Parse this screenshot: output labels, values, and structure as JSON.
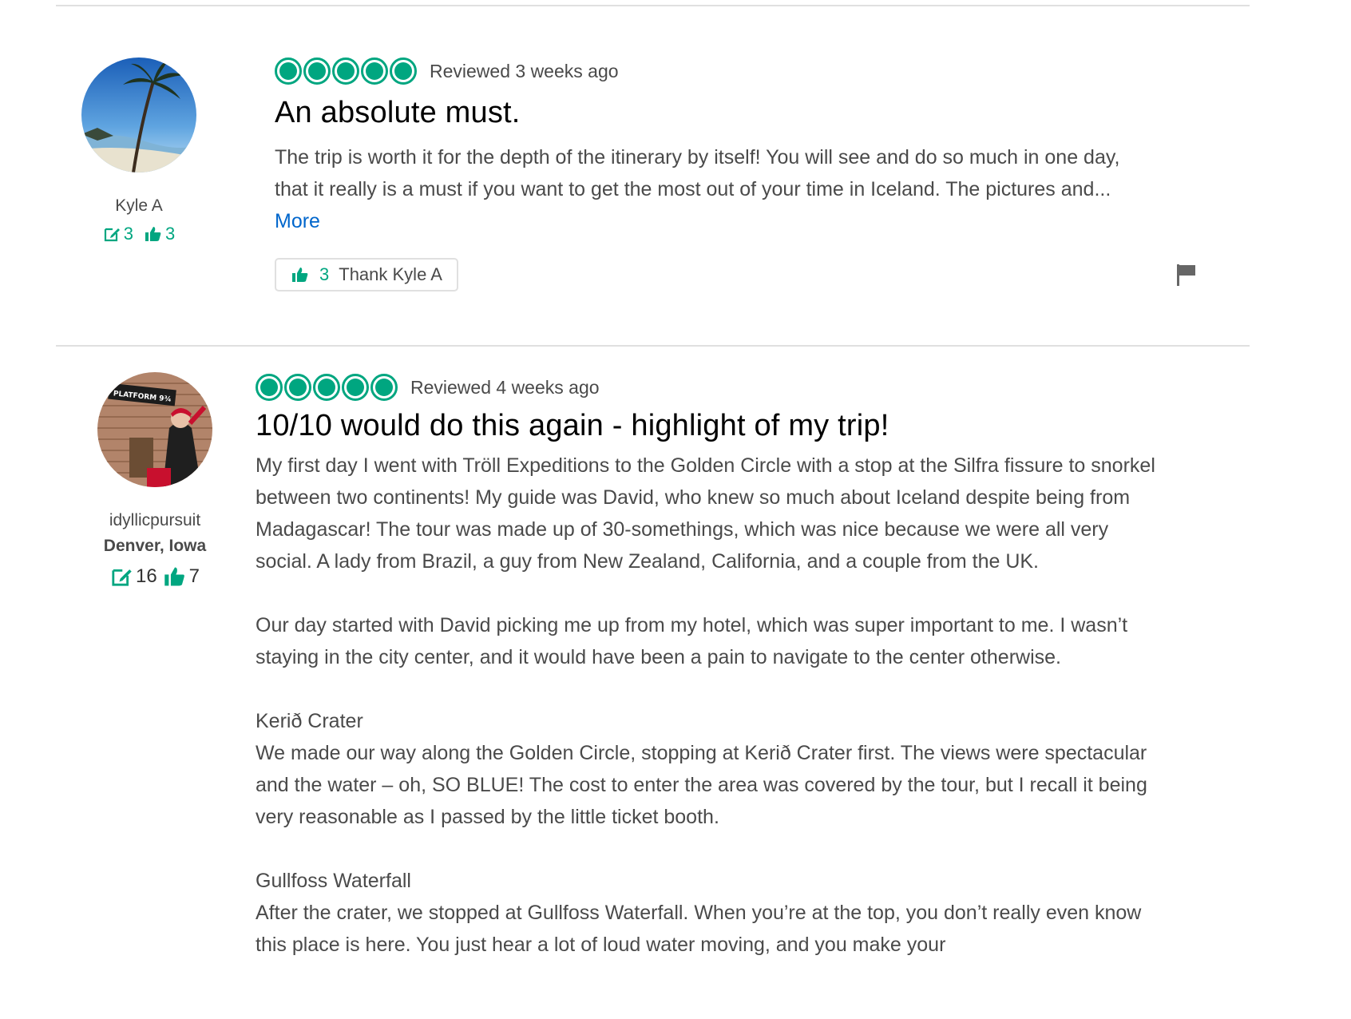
{
  "reviews": [
    {
      "reviewer": {
        "username": "Kyle A",
        "contributions": "3",
        "helpful_votes": "3",
        "avatar_icon": "beach-palm-photo"
      },
      "rating": 5,
      "review_date": "Reviewed 3 weeks ago",
      "title": "An absolute must.",
      "body": "The trip is worth it for the depth of the itinerary by itself! You will see and do so much in one day, that it really is a must if you want to get the most out of your time in Iceland. The pictures and... ",
      "more_label": "More",
      "thank_count": "3",
      "thank_label": "Thank Kyle A",
      "flag_icon": "flag-icon"
    },
    {
      "reviewer": {
        "username": "idyllicpursuit",
        "hometown": "Denver, Iowa",
        "contributions": "16",
        "helpful_votes": "7",
        "avatar_icon": "platform-photo",
        "avatar_sign_text": "PLATFORM 9¾"
      },
      "rating": 5,
      "review_date": "Reviewed 4 weeks ago",
      "title": "10/10 would do this again - highlight of my trip!",
      "paragraphs": [
        "My first day I went with Tröll Expeditions to the Golden Circle with a stop at the Silfra fissure to snorkel between two continents! My guide was David, who knew so much about Iceland despite being from Madagascar! The tour was made up of 30-somethings, which was nice because we were all very social. A lady from Brazil, a guy from New Zealand, California, and a couple from the UK.",
        "Our day started with David picking me up from my hotel, which was super important to me. I wasn’t staying in the city center, and it would have been a pain to navigate to the center otherwise."
      ],
      "sections": [
        {
          "heading": "Kerið Crater",
          "text": "We made our way along the Golden Circle, stopping at Kerið Crater first. The views were spectacular and the water – oh, SO BLUE! The cost to enter the area was covered by the tour, but I recall it being very reasonable as I passed by the little ticket booth."
        },
        {
          "heading": "Gullfoss Waterfall",
          "text": "After the crater, we stopped at Gullfoss Waterfall. When you’re at the top, you don’t really even know this place is here. You just hear a lot of loud water moving, and you make your"
        }
      ]
    }
  ],
  "colors": {
    "bubble_green": "#00a680",
    "link_blue": "#0066cc",
    "divider": "#e0e0e0"
  }
}
